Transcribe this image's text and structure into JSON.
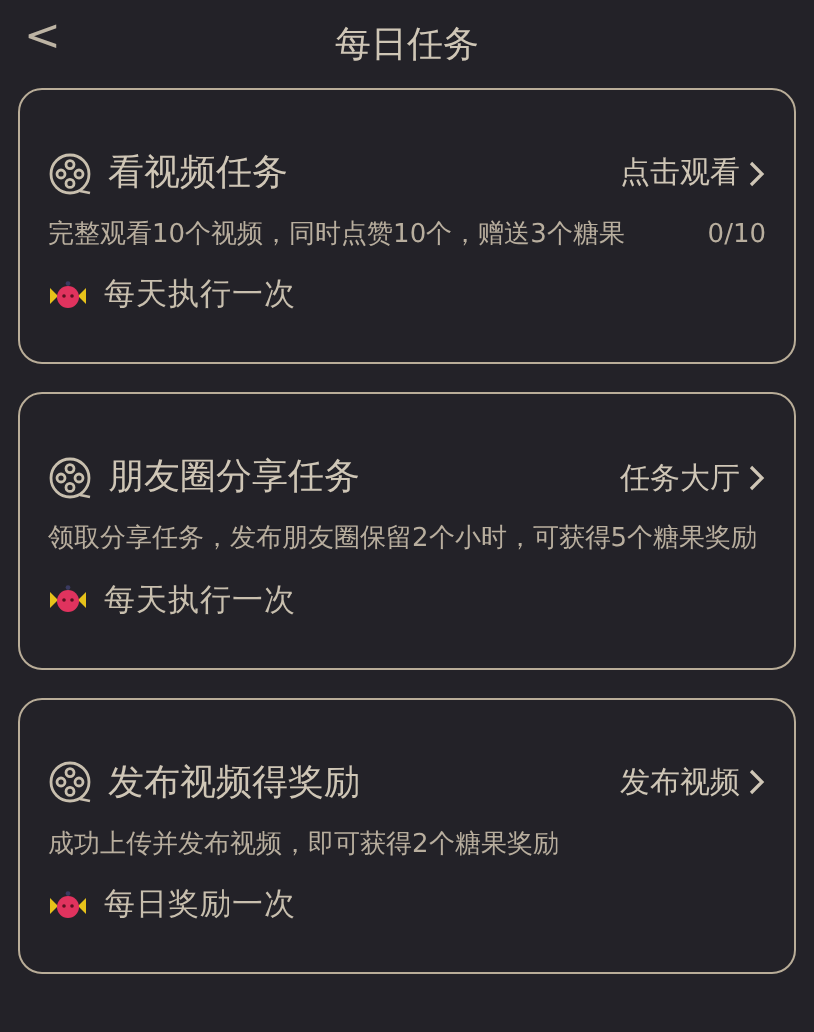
{
  "header": {
    "back": "<",
    "title": "每日任务"
  },
  "tasks": [
    {
      "title": "看视频任务",
      "action": "点击观看",
      "description": "完整观看10个视频，同时点赞10个，赠送3个糖果",
      "progress": "0/10",
      "frequency": "每天执行一次"
    },
    {
      "title": "朋友圈分享任务",
      "action": "任务大厅",
      "description": "领取分享任务，发布朋友圈保留2个小时，可获得5个糖果奖励",
      "frequency": "每天执行一次"
    },
    {
      "title": "发布视频得奖励",
      "action": "发布视频",
      "description": "成功上传并发布视频，即可获得2个糖果奖励",
      "frequency": "每日奖励一次"
    }
  ]
}
